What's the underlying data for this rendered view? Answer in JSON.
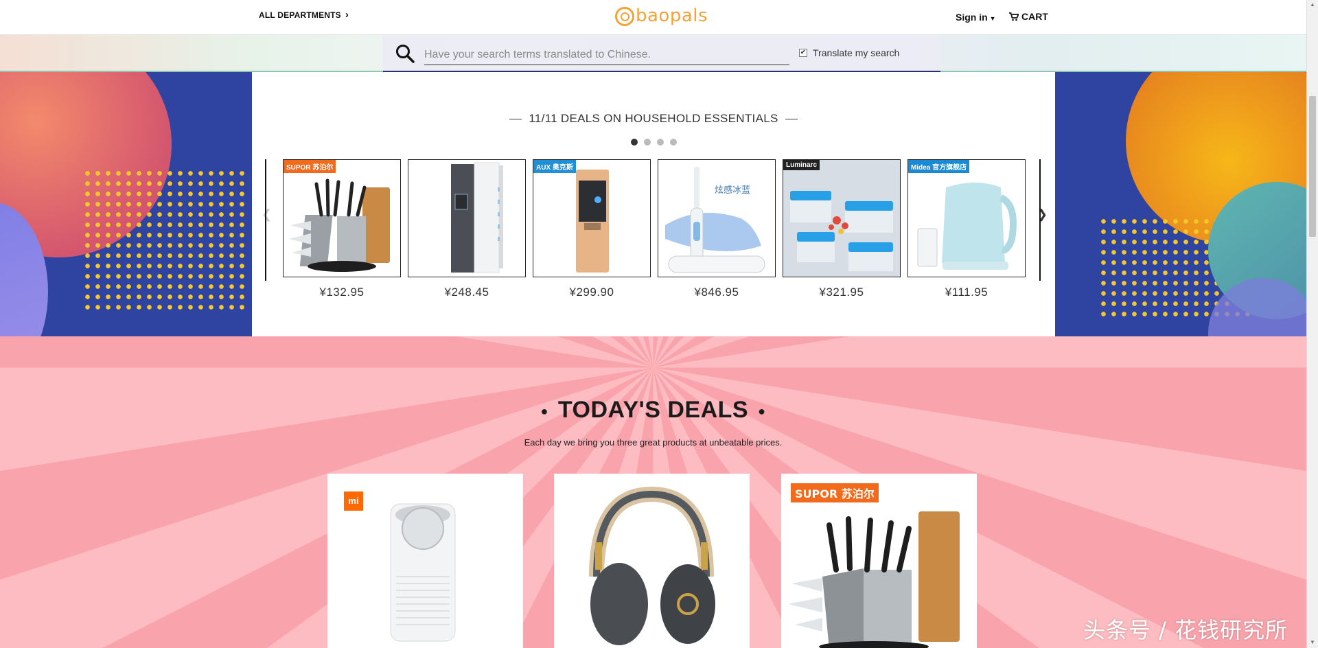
{
  "nav": {
    "departments": "ALL DEPARTMENTS",
    "logo": "baopals",
    "sign_in": "Sign in",
    "cart": "CART"
  },
  "search": {
    "placeholder": "Have your search terms translated to Chinese.",
    "translate_label": "Translate my search",
    "translate_checked": true
  },
  "banner": {
    "title": "11/11 DEALS ON HOUSEHOLD ESSENTIALS",
    "pages": 4,
    "active_page": 1,
    "products": [
      {
        "price": "¥132.95",
        "image": "knife-set-image",
        "tag": "SUPOR 苏泊尔",
        "tag_color": "#f26a1b"
      },
      {
        "price": "¥248.45",
        "image": "dehumidifier-image"
      },
      {
        "price": "¥299.90",
        "image": "water-dispenser-image",
        "tag": "AUX 奥克斯",
        "tag_color": "#1f8fd6"
      },
      {
        "price": "¥846.95",
        "image": "electric-toothbrush-image",
        "caption_cn": "炫感冰蓝"
      },
      {
        "price": "¥321.95",
        "image": "food-containers-image",
        "tag": "Luminarc",
        "tag_color": "#222222"
      },
      {
        "price": "¥111.95",
        "image": "electric-kettle-image",
        "tag": "Midea 官方旗舰店",
        "tag_color": "#1a8ad4"
      }
    ]
  },
  "todays_deals": {
    "title": "TODAY'S DEALS",
    "subtitle": "Each day we bring you three great products at unbeatable prices.",
    "cards": [
      {
        "image": "air-purifier-image",
        "tag": "mi",
        "tag_color": "#ff6900"
      },
      {
        "image": "headphones-image"
      },
      {
        "image": "knife-block-image",
        "tag": "SUPOR 苏泊尔",
        "tag_color": "#f26a1b"
      }
    ]
  },
  "watermark": "头条号 / 花钱研究所"
}
